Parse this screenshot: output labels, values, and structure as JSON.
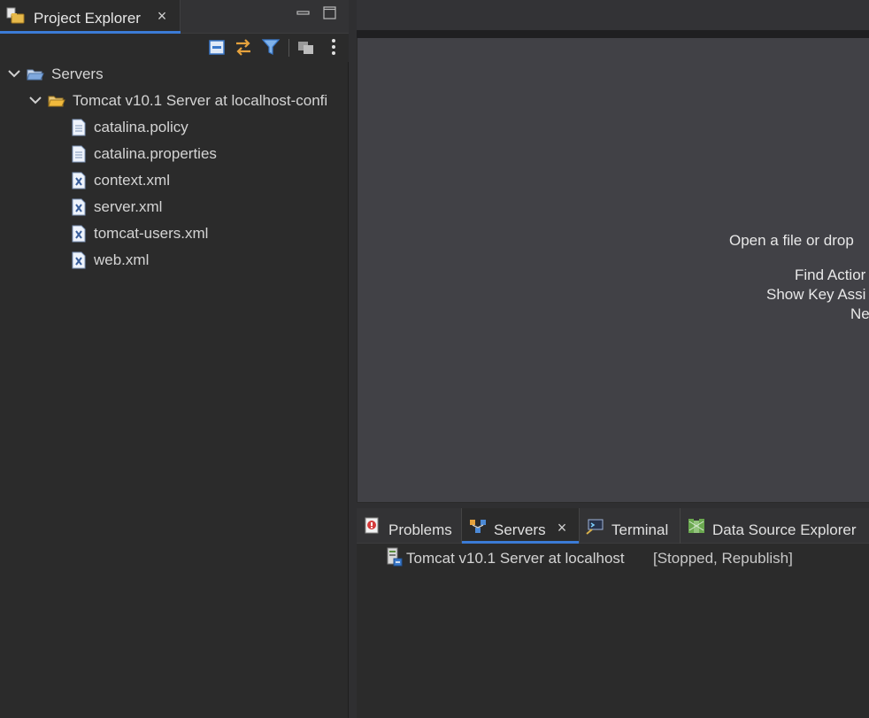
{
  "project_explorer": {
    "tab_label": "Project Explorer",
    "close_glyph": "×",
    "toolbar": {
      "collapse_all_icon": "collapse-all-icon",
      "link_with_editor_icon": "link-with-editor-icon",
      "filter_icon": "filter-icon",
      "select_working_set_icon": "working-set-icon",
      "view_menu_icon": "view-menu-icon"
    },
    "tree": [
      {
        "label": "Servers",
        "level": 0,
        "expanded": true,
        "icon": "open-folder-icon"
      },
      {
        "label": "Tomcat v10.1 Server at localhost-confi",
        "level": 1,
        "expanded": true,
        "icon": "open-folder-icon"
      },
      {
        "label": "catalina.policy",
        "level": 2,
        "icon": "text-file-icon"
      },
      {
        "label": "catalina.properties",
        "level": 2,
        "icon": "text-file-icon"
      },
      {
        "label": "context.xml",
        "level": 2,
        "icon": "xml-file-icon"
      },
      {
        "label": "server.xml",
        "level": 2,
        "icon": "xml-file-icon"
      },
      {
        "label": "tomcat-users.xml",
        "level": 2,
        "icon": "xml-file-icon"
      },
      {
        "label": "web.xml",
        "level": 2,
        "icon": "xml-file-icon"
      }
    ]
  },
  "editor": {
    "hints": [
      "Open a file or drop",
      "Find Actior",
      "Show Key Assi",
      "Ne"
    ]
  },
  "bottom_views": {
    "tabs": [
      {
        "label": "Problems",
        "icon": "problems-icon",
        "active": false
      },
      {
        "label": "Servers",
        "icon": "servers-icon",
        "active": true
      },
      {
        "label": "Terminal",
        "icon": "terminal-icon",
        "active": false
      },
      {
        "label": "Data Source Explorer",
        "icon": "data-source-icon",
        "active": false
      }
    ],
    "close_glyph": "×",
    "servers": [
      {
        "name": "Tomcat v10.1 Server at localhost",
        "state": "[Stopped, Republish]"
      }
    ]
  },
  "colors": {
    "accent": "#3b7bd6",
    "panel_bg": "#2b2b2b",
    "editor_bg": "#414146"
  }
}
